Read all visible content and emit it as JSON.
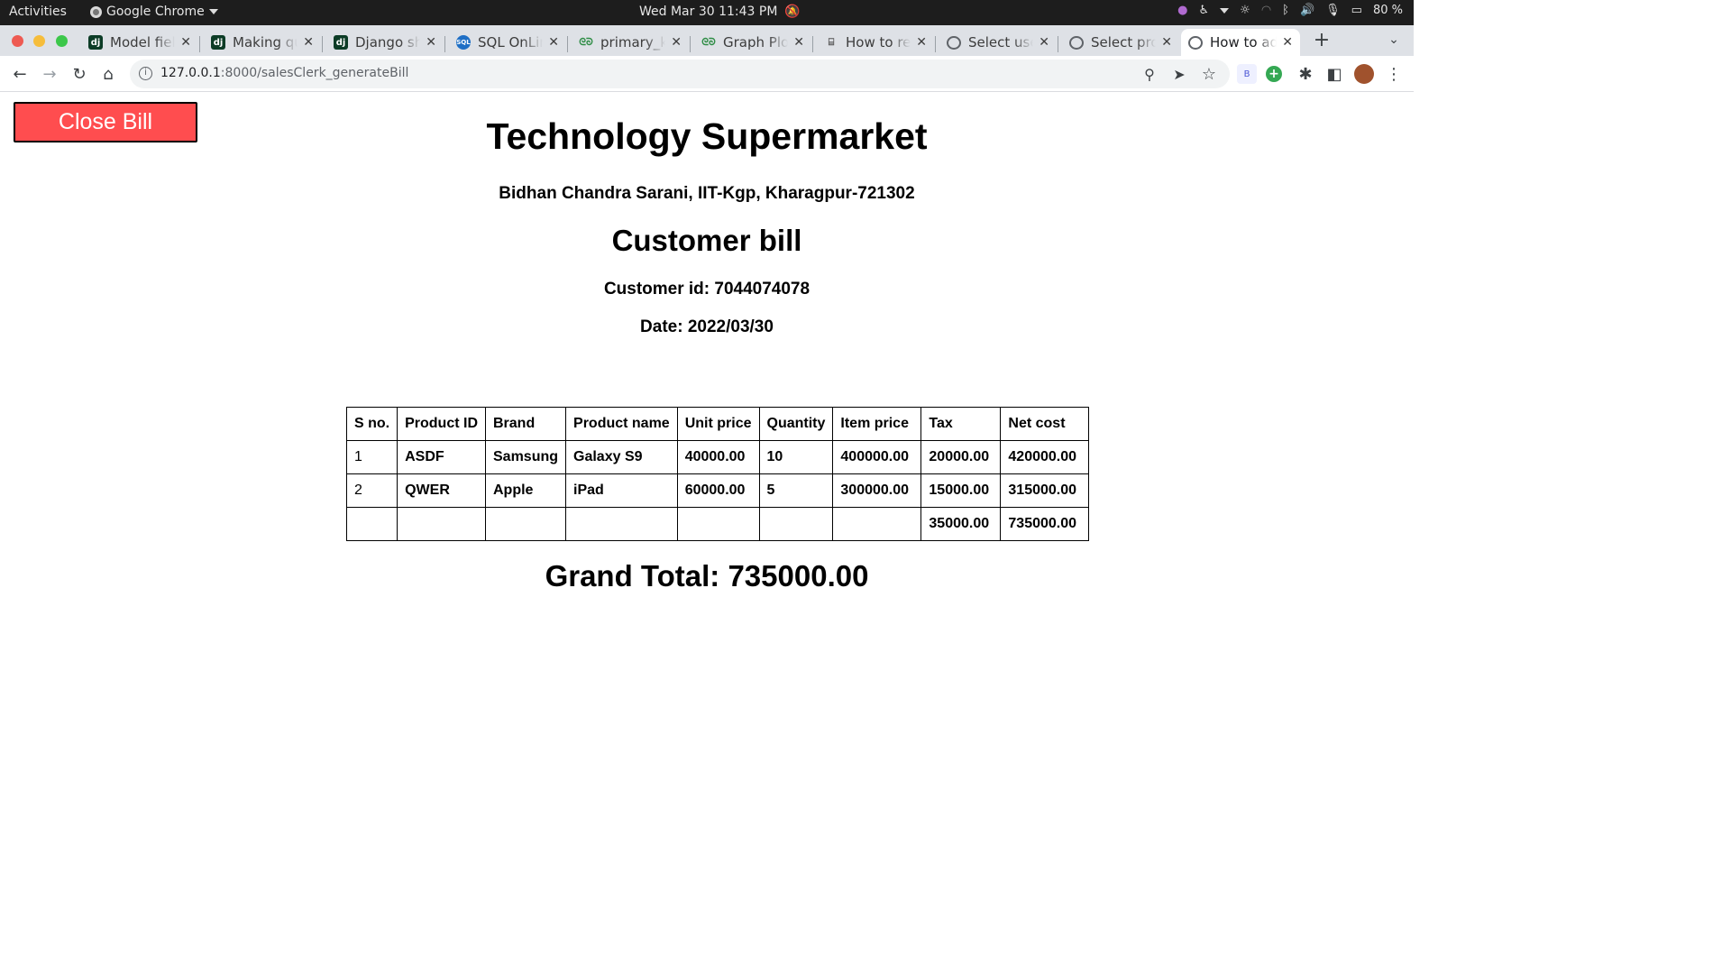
{
  "system_bar": {
    "activities": "Activities",
    "app_name": "Google Chrome",
    "datetime": "Wed Mar 30  11:43 PM",
    "battery": "80 %"
  },
  "tabs": [
    {
      "favicon": "dj",
      "title": "Model fiel"
    },
    {
      "favicon": "dj",
      "title": "Making qu"
    },
    {
      "favicon": "dj",
      "title": "Django sh"
    },
    {
      "favicon": "sql",
      "title": "SQL OnLin"
    },
    {
      "favicon": "gfg",
      "title": "primary_k"
    },
    {
      "favicon": "gfg",
      "title": "Graph Plo"
    },
    {
      "favicon": "hw",
      "title": "How to re"
    },
    {
      "favicon": "globe",
      "title": "Select use"
    },
    {
      "favicon": "globe",
      "title": "Select pro"
    },
    {
      "favicon": "globe",
      "title": "How to ad",
      "active": true
    }
  ],
  "address_bar": {
    "host": "127.0.0.1",
    "path": ":8000/salesClerk_generateBill"
  },
  "page": {
    "close_button": "Close Bill",
    "store_name": "Technology Supermarket",
    "store_address": "Bidhan Chandra Sarani, IIT-Kgp, Kharagpur-721302",
    "bill_heading": "Customer bill",
    "customer_line": "Customer id: 7044074078",
    "date_line": "Date: 2022/03/30",
    "table": {
      "headers": [
        "S no.",
        "Product ID",
        "Brand",
        "Product name",
        "Unit price",
        "Quantity",
        "Item price",
        "Tax",
        "Net cost"
      ],
      "rows": [
        [
          "1",
          "ASDF",
          "Samsung",
          "Galaxy S9",
          "40000.00",
          "10",
          "400000.00",
          "20000.00",
          "420000.00"
        ],
        [
          "2",
          "QWER",
          "Apple",
          "iPad",
          "60000.00",
          "5",
          "300000.00",
          "15000.00",
          "315000.00"
        ],
        [
          "",
          "",
          "",
          "",
          "",
          "",
          "",
          "35000.00",
          "735000.00"
        ]
      ]
    },
    "grand_total": "Grand Total: 735000.00"
  },
  "colors": {
    "close_button_bg": "#ff4d4f",
    "tabstrip_bg": "#dee1e6",
    "topbar_bg": "#1d1d1d"
  }
}
